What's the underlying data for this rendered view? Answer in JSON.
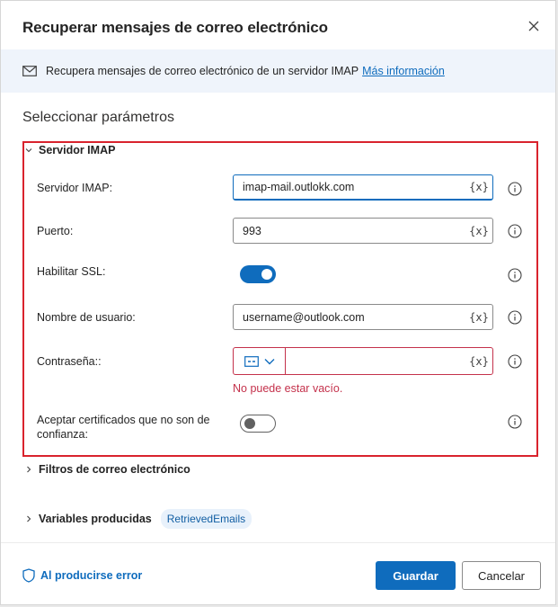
{
  "dialog": {
    "title": "Recuperar mensajes de correo electrónico",
    "info_text": "Recupera mensajes de correo electrónico de un servidor IMAP",
    "info_link": "Más información",
    "section_title": "Seleccionar parámetros"
  },
  "imap_group": {
    "header": "Servidor IMAP",
    "fields": {
      "server": {
        "label": "Servidor IMAP:",
        "value": "imap-mail.outlokk.com",
        "var_button": "{x}"
      },
      "port": {
        "label": "Puerto:",
        "value": "993",
        "var_button": "{x}"
      },
      "ssl": {
        "label": "Habilitar SSL:",
        "enabled": true
      },
      "username": {
        "label": "Nombre de usuario:",
        "value": "username@outlook.com",
        "var_button": "{x}"
      },
      "password": {
        "label": "Contraseña::",
        "value": "",
        "var_button": "{x}",
        "error": "No puede estar vacío."
      },
      "accept_certs": {
        "label_line1": "Aceptar certificados que no son de",
        "label_line2": "confianza:",
        "enabled": false
      }
    }
  },
  "collapsed_sections": {
    "filters": "Filtros de correo electrónico",
    "variables": "Variables producidas",
    "variables_pill": "RetrievedEmails"
  },
  "footer": {
    "error_link": "Al producirse error",
    "save_label": "Guardar",
    "cancel_label": "Cancelar"
  },
  "colors": {
    "accent": "#0f6cbd",
    "error": "#c4314b",
    "highlight_border": "#d9232d",
    "info_bar": "#eff4fb"
  },
  "icons": [
    "close-icon",
    "mail-icon",
    "chevron-down-icon",
    "chevron-right-icon",
    "info-icon",
    "password-type-icon",
    "shield-icon"
  ]
}
